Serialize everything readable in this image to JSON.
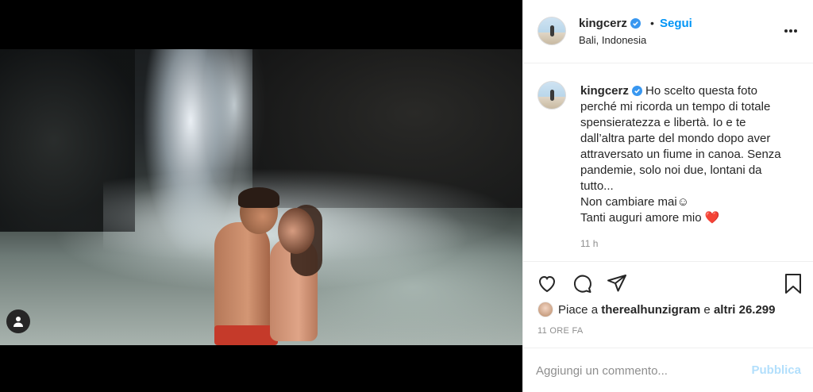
{
  "post": {
    "username": "kingcerz",
    "follow_label": "Segui",
    "separator": "•",
    "location": "Bali, Indonesia"
  },
  "caption": {
    "username": "kingcerz",
    "lines": [
      "Ho scelto questa foto",
      "perché mi ricorda un tempo di totale",
      "spensieratezza e libertà. Io e te",
      "dall’altra parte del mondo dopo aver",
      "attraversato un fiume in canoa. Senza",
      "pandemie, solo noi due, lontani da",
      "tutto...",
      "Non cambiare mai☺︎",
      "Tanti auguri amore mio ❤️"
    ],
    "time_ago": "11 h"
  },
  "likes": {
    "prefix": "Piace a",
    "user": "therealhunzigram",
    "middle": "e",
    "others": "altri 26.299"
  },
  "date_label": "11 ORE FA",
  "comment": {
    "placeholder": "Aggiungi un commento...",
    "publish_label": "Pubblica"
  },
  "colors": {
    "accent": "#0095f6",
    "publish_disabled": "#b2dffc",
    "verified": "#3897f0"
  },
  "icons": [
    "verified-icon",
    "more-options-icon",
    "heart-icon",
    "comment-icon",
    "share-icon",
    "bookmark-icon",
    "user-tag-icon"
  ]
}
